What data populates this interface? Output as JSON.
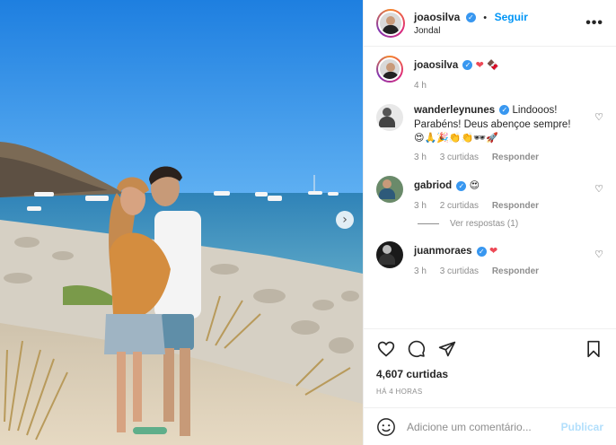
{
  "header": {
    "username": "joaosilva",
    "separator": "•",
    "follow_label": "Seguir",
    "location": "Jondal",
    "more_label": "•••"
  },
  "caption": {
    "username": "joaosilva",
    "emojis": "❤ 🍫",
    "time": "4 h"
  },
  "comments": [
    {
      "username": "wanderleynunes",
      "text": "Lindooos! Parabéns! Deus abençoe sempre!",
      "emojis": "😍🙏🎉👏👏🕶🚀",
      "time": "3 h",
      "likes": "3 curtidas",
      "reply": "Responder"
    },
    {
      "username": "gabriod",
      "text": "😍",
      "time": "3 h",
      "likes": "2 curtidas",
      "reply": "Responder",
      "view_replies": "Ver respostas (1)"
    },
    {
      "username": "juanmoraes",
      "text": "❤",
      "time": "3 h",
      "likes": "3 curtidas",
      "reply": "Responder"
    }
  ],
  "likes_count": "4,607 curtidas",
  "posted_time": "HÁ 4 HORAS",
  "comment_box": {
    "placeholder": "Adicione um comentário...",
    "publish_label": "Publicar"
  },
  "media": {
    "next_label": "›"
  }
}
